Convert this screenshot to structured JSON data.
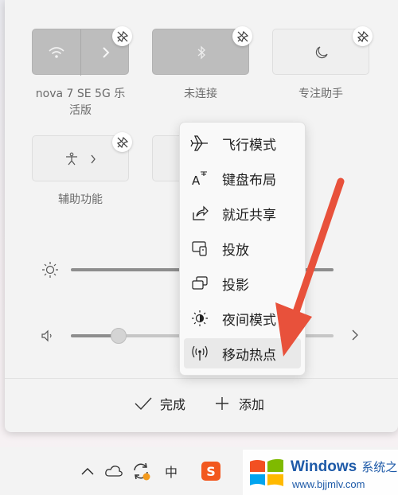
{
  "tiles": [
    {
      "label": "nova 7 SE 5G 乐活版",
      "icon": "wifi-icon",
      "state": "on"
    },
    {
      "label": "未连接",
      "icon": "bluetooth-icon",
      "state": "on"
    },
    {
      "label": "专注助手",
      "icon": "moon-icon",
      "state": "off"
    },
    {
      "label": "辅助功能",
      "icon": "accessibility-icon",
      "state": "off"
    }
  ],
  "context_menu": {
    "items": [
      {
        "label": "飞行模式",
        "icon": "airplane-icon"
      },
      {
        "label": "键盘布局",
        "icon": "keyboard-layout-icon"
      },
      {
        "label": "就近共享",
        "icon": "nearby-share-icon"
      },
      {
        "label": "投放",
        "icon": "cast-icon"
      },
      {
        "label": "投影",
        "icon": "project-icon"
      },
      {
        "label": "夜间模式",
        "icon": "night-light-icon"
      },
      {
        "label": "移动热点",
        "icon": "mobile-hotspot-icon"
      }
    ]
  },
  "sliders": {
    "brightness": {
      "icon": "brightness-icon"
    },
    "volume": {
      "icon": "speaker-icon",
      "level": 0.17
    }
  },
  "footer": {
    "done_label": "完成",
    "add_label": "添加"
  },
  "taskbar": {
    "ime_label": "中",
    "sogou_label": "S"
  },
  "watermark": {
    "title": "Windows",
    "title_cn": "系统之家",
    "url": "www.bjjmlv.com"
  },
  "colors": {
    "arrow": "#e8513b",
    "tile_on": "#bdbdbd",
    "tile_off": "#efefef"
  }
}
